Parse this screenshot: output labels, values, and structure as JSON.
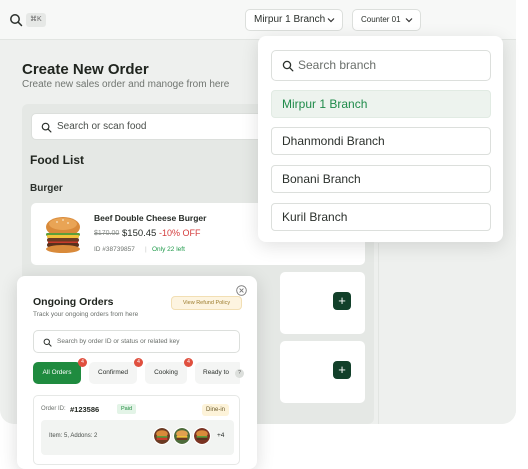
{
  "topbar": {
    "shortcut": "⌘K",
    "branch_selected": "Mirpur 1 Branch",
    "counter_selected": "Counter 01"
  },
  "page": {
    "title": "Create New Order",
    "subtitle": "Create new sales order and manoge from here"
  },
  "food": {
    "search_placeholder": "Search or scan food",
    "list_title": "Food List",
    "category": "Burger",
    "items": [
      {
        "name": "Beef Double Cheese Burger",
        "old_price": "$170.00",
        "price": "$150.45",
        "discount": "-10% OFF",
        "id": "ID #38739857",
        "separator": "|",
        "stock": "Only 22 left"
      }
    ],
    "add_label": "+"
  },
  "branch_dropdown": {
    "search_placeholder": "Search branch",
    "options": [
      "Mirpur 1 Branch",
      "Dhanmondi Branch",
      "Bonani Branch",
      "Kuril Branch"
    ],
    "selected": "Mirpur 1 Branch"
  },
  "orders_modal": {
    "title": "Ongoing Orders",
    "subtitle": "Track your ongoing orders from here",
    "refund_button": "View Refund Policy",
    "search_placeholder": "Search by order ID or status or related key",
    "tabs": [
      {
        "label": "All Orders",
        "count": "4"
      },
      {
        "label": "Confirmed",
        "count": "4"
      },
      {
        "label": "Cooking",
        "count": "4"
      },
      {
        "label": "Ready to",
        "count": "?"
      }
    ],
    "order": {
      "id_label": "Order ID:",
      "id": "#123586",
      "payment_status": "Paid",
      "service_type": "Dine-in",
      "items_summary": "Item:  5,  Addons:  2",
      "more_count": "+4"
    }
  },
  "colors": {
    "primary_green": "#1f8b3f",
    "dark_green": "#12402a",
    "discount_red": "#d43d3d",
    "badge_red": "#e0503f"
  },
  "icons": [
    "search-icon",
    "chevron-down-icon",
    "close-icon",
    "plus-icon",
    "burger-image"
  ]
}
